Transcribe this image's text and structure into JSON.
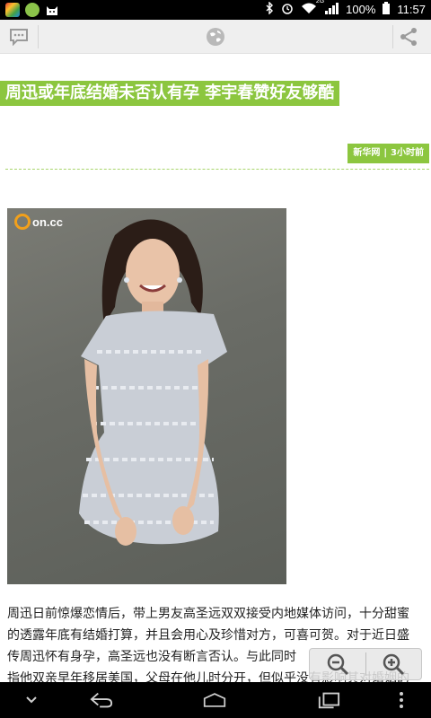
{
  "status_bar": {
    "signal_label": "2G",
    "battery": "100%",
    "time": "11:57"
  },
  "toolbar": {
    "left_icon": "comment-icon",
    "center_icon": "globe-icon",
    "right_icon": "share-icon"
  },
  "article": {
    "title": "周迅或年底结婚未否认有孕 李宇春赞好友够酷",
    "source_name": "新华网",
    "time_ago": "3小时前",
    "photo_watermark": "on.cc",
    "body_lines": [
      "周迅日前惊爆恋情后，带上男友高圣远双双接受内地媒体访问，十分甜蜜",
      "的透露年底有结婚打算，并且会用心及珍惜对方，可喜可贺。对于近日盛",
      "传周迅怀有身孕，高圣远也没有断言否认。与此同时",
      "指他双亲早年移居美国，父母在他儿时分开，但似乎没有影响其对婚姻的"
    ]
  },
  "colors": {
    "accent": "#8cc63f",
    "toolbar_bg": "#efefef"
  },
  "navbar": {
    "icons": [
      "down-chevron-icon",
      "back-icon",
      "home-icon",
      "recent-apps-icon",
      "menu-icon"
    ]
  }
}
